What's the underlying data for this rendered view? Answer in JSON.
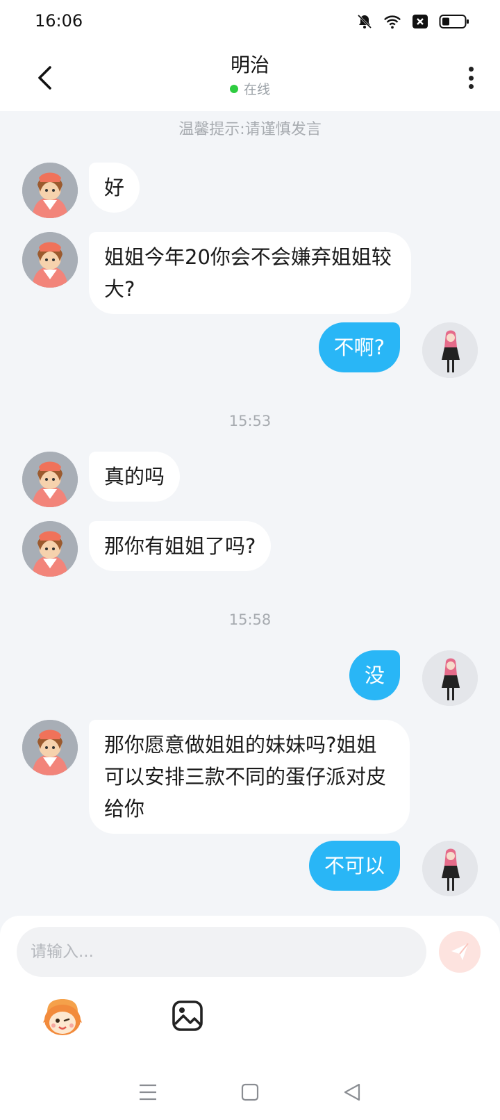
{
  "status_bar": {
    "time": "16:06",
    "icons": [
      "bell-muted-icon",
      "wifi-icon",
      "close-box-icon",
      "battery-icon"
    ]
  },
  "header": {
    "back_icon": "back-arrow-icon",
    "title": "明治",
    "status": "在线",
    "status_color": "#2ecc40",
    "more_icon": "more-vertical-icon"
  },
  "chat": {
    "tip": "温馨提示:请谨慎发言",
    "timestamps": [
      "15:53",
      "15:58"
    ],
    "messages": [
      {
        "side": "in",
        "text": "好"
      },
      {
        "side": "in",
        "text": "姐姐今年20你会不会嫌弃姐姐较大?"
      },
      {
        "side": "out",
        "text": "不啊?"
      },
      {
        "side": "in",
        "text": "真的吗"
      },
      {
        "side": "in",
        "text": "那你有姐姐了吗?"
      },
      {
        "side": "out",
        "text": "没"
      },
      {
        "side": "in",
        "text": "那你愿意做姐姐的妹妹吗?姐姐可以安排三款不同的蛋仔派对皮给你"
      },
      {
        "side": "out",
        "text": "不可以"
      }
    ]
  },
  "composer": {
    "placeholder": "请输入...",
    "send_icon": "send-icon",
    "tools": [
      "emoji-mascot-icon",
      "image-icon"
    ]
  },
  "nav_bar": {
    "icons": [
      "menu-icon",
      "home-square-icon",
      "back-triangle-icon"
    ]
  },
  "colors": {
    "background": "#f3f5f8",
    "outgoing_bubble": "#29b6f6",
    "incoming_bubble": "#ffffff",
    "send_button": "#fde3df"
  }
}
